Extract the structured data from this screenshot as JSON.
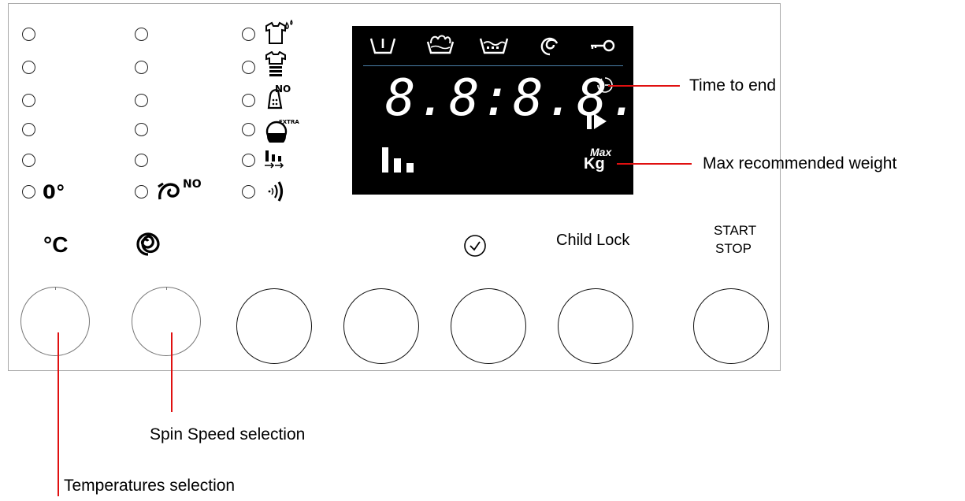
{
  "panel": {
    "labels": {
      "temp_zero": "0°",
      "spin_no": "NO",
      "celsius": "°C",
      "child_lock": "Child Lock",
      "start": "START",
      "stop": "STOP"
    },
    "options": {
      "iron_no": "NO",
      "extra": "EXTRA"
    },
    "display": {
      "digits": "8.8:8.8.",
      "kg": "Kg",
      "max": "Max",
      "top_icons": [
        "prewash-icon",
        "wash-icon",
        "rinse-icon",
        "spin-icon",
        "key-lock-icon"
      ]
    }
  },
  "annotations": {
    "time_to_end": "Time to end",
    "max_weight": "Max recommended weight",
    "spin_speed": "Spin Speed selection",
    "temperatures": "Temperatures selection"
  },
  "colors": {
    "callout_line": "#e01010",
    "display_bg": "#000000",
    "display_divider": "#4a7fa8"
  }
}
